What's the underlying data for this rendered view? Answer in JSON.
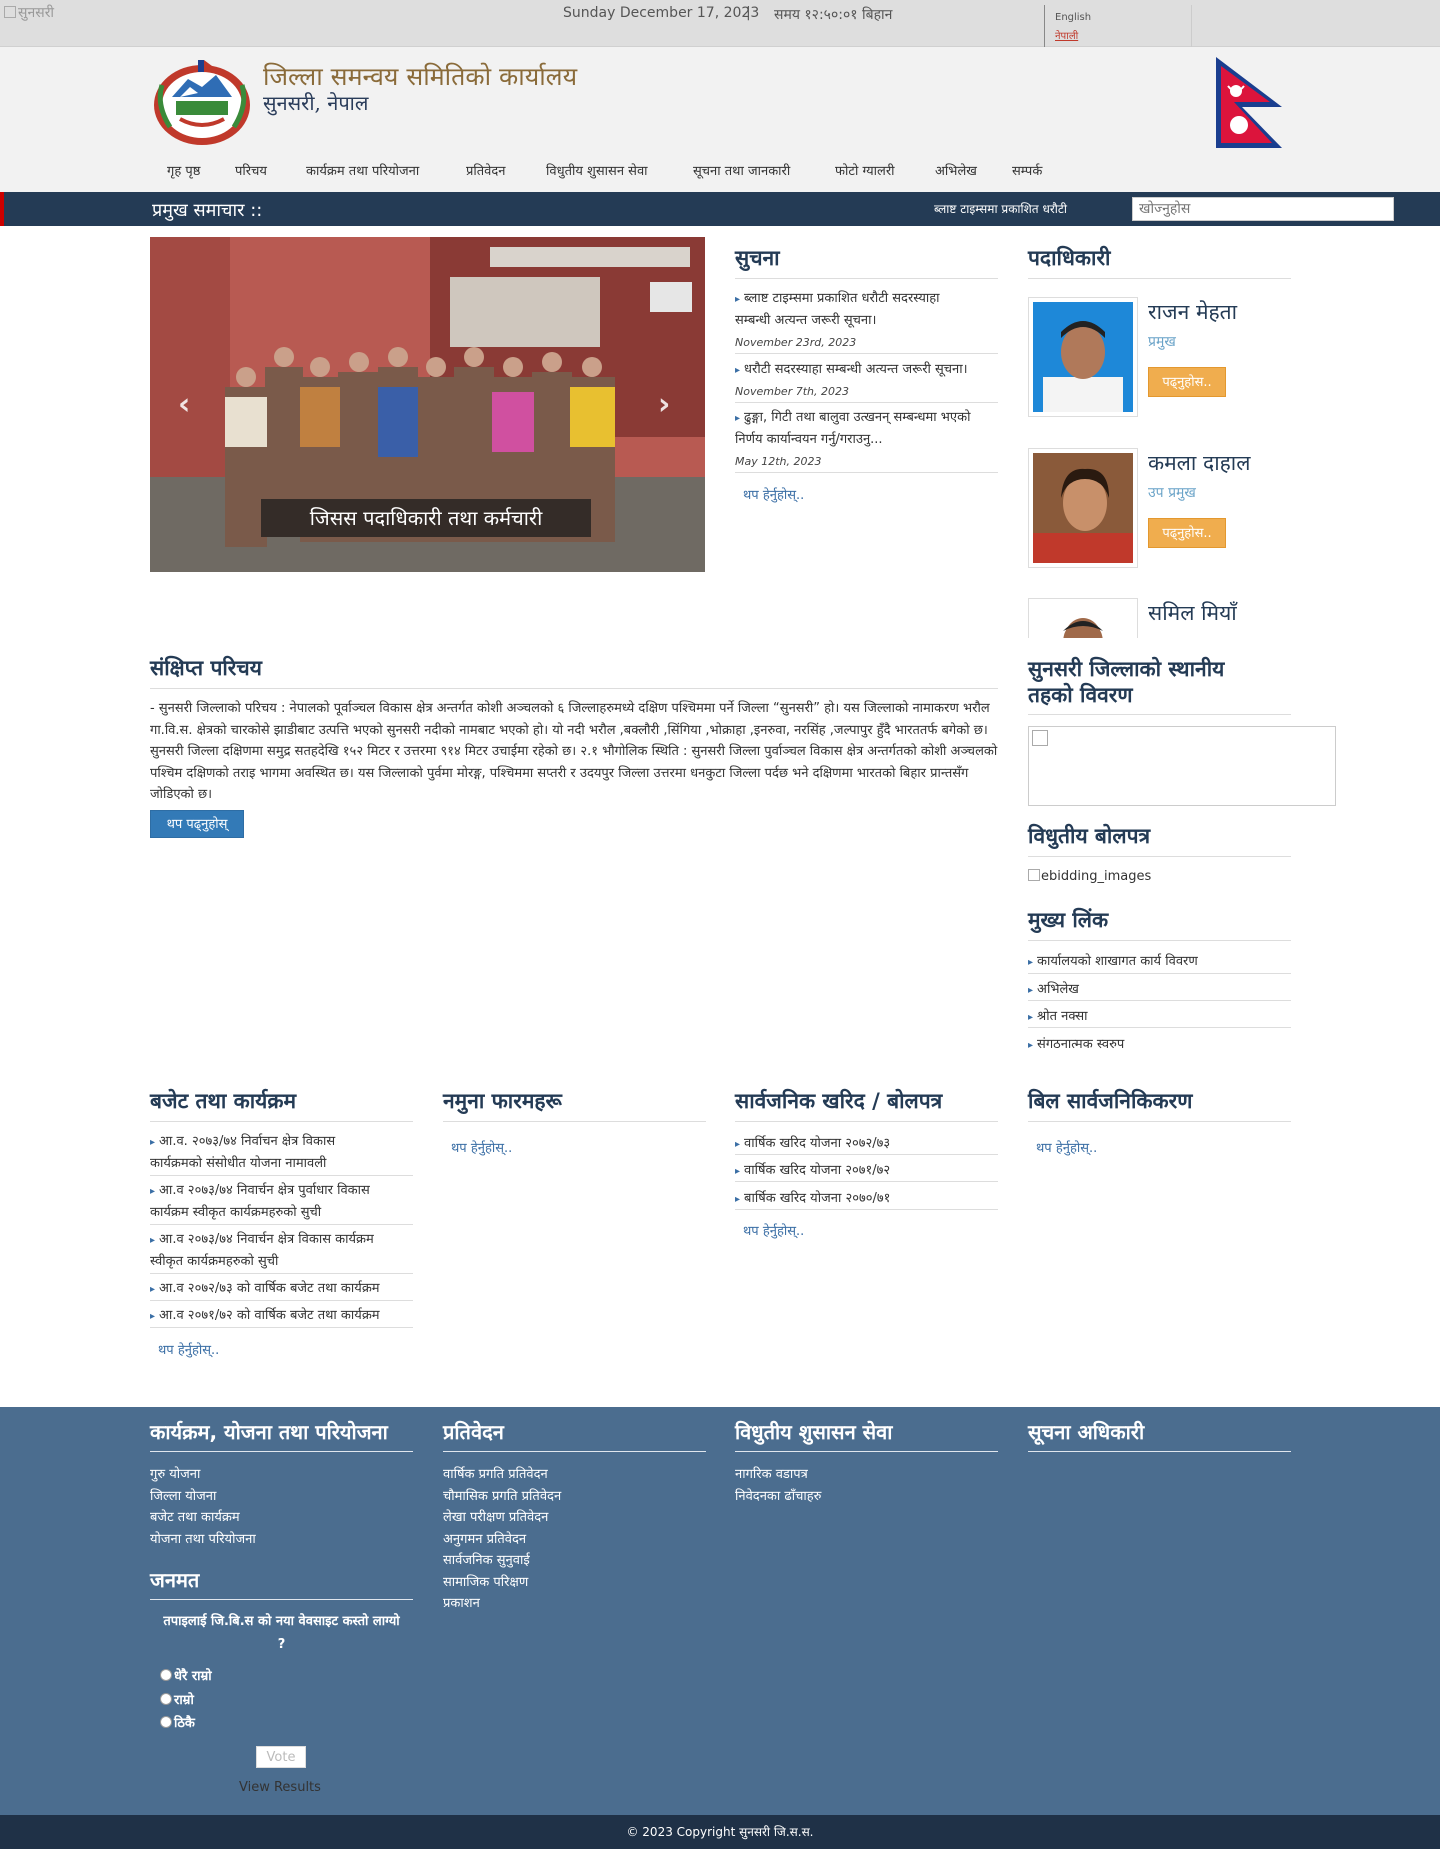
{
  "topbar": {
    "broken_logo_alt": "सुनसरी",
    "date": "Sunday December 17, 2023",
    "separator": "|",
    "time": "समय १२:५०:०१ बिहान",
    "lang_english": "English",
    "lang_nepali": "नेपाली"
  },
  "header": {
    "title": "जिल्ला समन्वय समितिको कार्यालय",
    "subtitle": "सुनसरी, नेपाल"
  },
  "nav": [
    "गृह पृष्ठ",
    "परिचय",
    "कार्यक्रम तथा परियोजना",
    "प्रतिवेदन",
    "विधुतीय शुसासन सेवा",
    "सूचना तथा जानकारी",
    "फोटो ग्यालरी",
    "अभिलेख",
    "सम्पर्क"
  ],
  "newsbar": {
    "label": "प्रमुख समाचार ::",
    "ticker": "ब्लाष्ट टाइम्समा प्रकाशित धरौटी",
    "search_placeholder": "खोज्नुहोस"
  },
  "slider": {
    "caption": "जिसस पदाधिकारी तथा कर्मचारी",
    "prev": "‹",
    "next": "›"
  },
  "notices": {
    "heading": "सुचना",
    "items": [
      {
        "text_line1": "ब्लाष्ट टाइम्समा प्रकाशित धरौटी सदरस्याहा",
        "text_line2": "सम्बन्धी अत्यन्त जरूरी सूचना।",
        "date": "November 23rd, 2023"
      },
      {
        "text_line1": "धरौटी सदरस्याहा सम्बन्धी अत्यन्त जरूरी सूचना।",
        "text_line2": "",
        "date": "November 7th, 2023"
      },
      {
        "text_line1": "ढुङ्गा, गिटी तथा बालुवा उत्खनन् सम्बन्धमा भएको",
        "text_line2": "निर्णय कार्यान्वयन गर्नु/गराउनु...",
        "date": "May 12th, 2023"
      }
    ],
    "more": "थप हेर्नुहोस्.."
  },
  "officials": {
    "heading": "पदाधिकारी",
    "items": [
      {
        "name": "राजन मेहता",
        "role": "प्रमुख",
        "button": "पढ्नुहोस.."
      },
      {
        "name": "कमला दाहाल",
        "role": "उप प्रमुख",
        "button": "पढ्नुहोस.."
      },
      {
        "name": "समिल मियाँ",
        "role": "",
        "button": ""
      }
    ]
  },
  "intro": {
    "heading": "संक्षिप्त परिचय",
    "text": "- सुनसरी जिल्लाको परिचय : नेपालको पूर्वाञ्चल विकास क्षेत्र अन्तर्गत कोशी अञ्चलको ६ जिल्लाहरुमध्ये दक्षिण पश्चिममा पर्ने जिल्ला “सुनसरी” हो। यस जिल्लाको नामाकरण भरौल गा.वि.स. क्षेत्रको चारकोसे झाडीबाट उत्पत्ति भएको सुनसरी नदीको नामबाट भएको हो। यो नदी भरौल ,बक्लौरी ,सिंगिया ,भोक्राहा ,इनरुवा, नरसिंह ,जल्पापुर हुँदै भारततर्फ बगेको छ। सुनसरी जिल्ला दक्षिणमा समुद्र सतहदेखि १५२ मिटर र उत्तरमा ९१४ मिटर उचाईमा रहेको छ। २.१ भौगोलिक स्थिति : सुनसरी जिल्ला पुर्वाञ्चल विकास क्षेत्र अन्तर्गतको कोशी अञ्चलको पश्चिम दक्षिणको तराइ भागमा अवस्थित छ। यस जिल्लाको पुर्वमा मोरङ्ग, पश्चिममा सप्तरी र उदयपुर जिल्ला उत्तरमा धनकुटा जिल्ला पर्दछ भने दक्षिणमा भारतको बिहार प्रान्तसँग जोडिएको छ।",
    "button": "थप पढ्नुहोस्"
  },
  "local": {
    "heading_line1": "सुनसरी जिल्लाको स्थानीय",
    "heading_line2": "तहको विवरण"
  },
  "ebid": {
    "heading": "विधुतीय बोलपत्र",
    "alt": "ebidding_images"
  },
  "main_links": {
    "heading": "मुख्य लिंक",
    "items": [
      "कार्यालयको शाखागत कार्य विवरण",
      "अभिलेख",
      "श्रोत नक्सा",
      "संगठनात्मक स्वरुप"
    ]
  },
  "budget": {
    "heading": "बजेट तथा कार्यक्रम",
    "items": [
      {
        "line1": "आ.व. २०७३/७४ निर्वाचन क्षेत्र विकास",
        "line2": "कार्यक्रमको संसोधीत योजना नामावली"
      },
      {
        "line1": "आ.व २०७३/७४ निवार्चन क्षेत्र पुर्वाधार विकास",
        "line2": "कार्यक्रम स्वीकृत कार्यक्रमहरुको सुची"
      },
      {
        "line1": "आ.व २०७३/७४ निवार्चन क्षेत्र विकास कार्यक्रम",
        "line2": "स्वीकृत कार्यक्रमहरुको सुची"
      },
      {
        "line1": "आ.व २०७२/७३ को वार्षिक बजेट तथा कार्यक्रम",
        "line2": ""
      },
      {
        "line1": "आ.व २०७१/७२ को वार्षिक बजेट तथा कार्यक्रम",
        "line2": ""
      }
    ],
    "more": "थप हेर्नुहोस्.."
  },
  "forms": {
    "heading": "नमुना फारमहरू",
    "more": "थप हेर्नुहोस्.."
  },
  "procurement": {
    "heading": "सार्वजनिक खरिद / बोलपत्र",
    "items": [
      "वार्षिक खरिद योजना २०७२/७३",
      "वार्षिक खरिद योजना २०७१/७२",
      "बार्षिक खरिद योजना २०७०/७१"
    ],
    "more": "थप हेर्नुहोस्.."
  },
  "bills": {
    "heading": "बिल सार्वजनिकिकरण",
    "more": "थप हेर्नुहोस्.."
  },
  "footer": {
    "col1": {
      "heading": "कार्यक्रम, योजना तथा परियोजना",
      "links": [
        "गुरु योजना",
        "जिल्ला योजना",
        "बजेट तथा कार्यक्रम",
        "योजना तथा परियोजना"
      ]
    },
    "col2": {
      "heading": "प्रतिवेदन",
      "links": [
        "वार्षिक प्रगति प्रतिवेदन",
        "चौमासिक प्रगति प्रतिवेदन",
        "लेखा परीक्षण प्रतिवेदन",
        "अनुगमन प्रतिवेदन",
        "सार्वजनिक सुनुवाई",
        "सामाजिक परिक्षण",
        "प्रकाशन"
      ]
    },
    "col3": {
      "heading": "विधुतीय शुसासन सेवा",
      "links": [
        "नागरिक वडापत्र",
        "निवेदनका ढाँचाहरु"
      ]
    },
    "col4": {
      "heading": "सूचना अधिकारी"
    },
    "poll": {
      "heading": "जनमत",
      "question_line1": "तपाइलाई जि.बि.स को नया वेवसाइट कस्तो लाग्यो",
      "question_line2": "?",
      "options": [
        "धेरै राम्रो",
        "राम्रो",
        "ठिकै"
      ],
      "vote": "Vote",
      "view_results": "View Results"
    }
  },
  "copyright": "© 2023 Copyright सुनसरी जि.स.स."
}
